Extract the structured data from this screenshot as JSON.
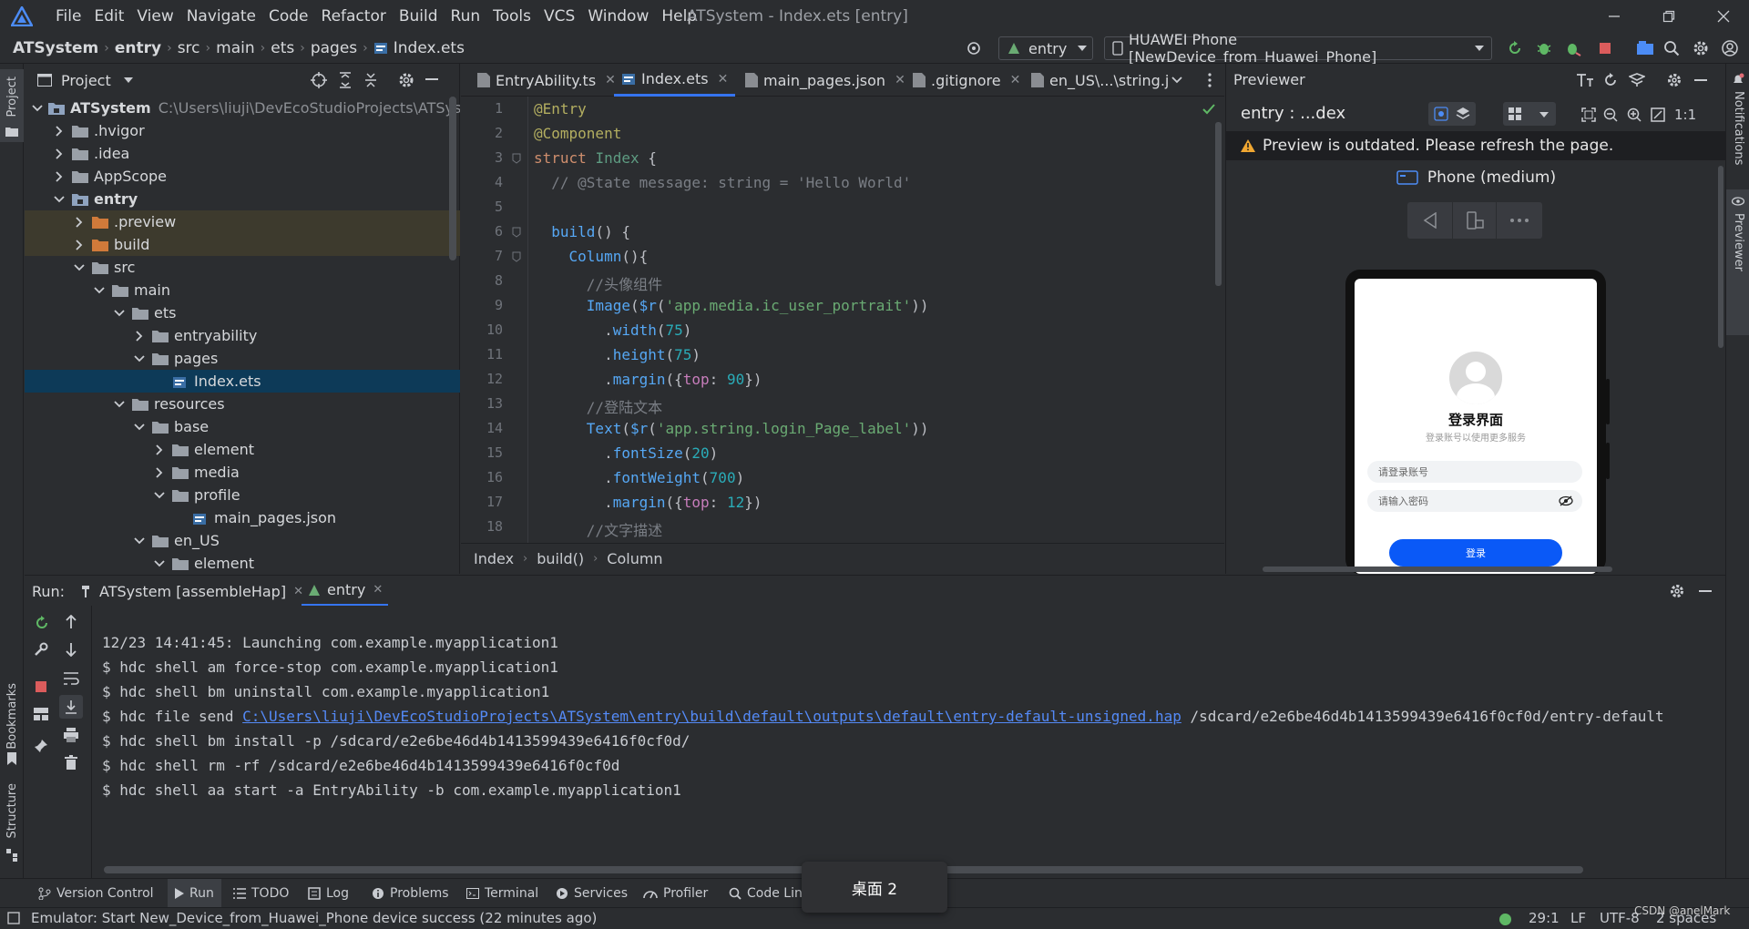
{
  "menubar": {
    "items": [
      "File",
      "Edit",
      "View",
      "Navigate",
      "Code",
      "Refactor",
      "Build",
      "Run",
      "Tools",
      "VCS",
      "Window",
      "Help"
    ],
    "window_title": "ATSystem - Index.ets [entry]"
  },
  "navbar": {
    "crumbs": [
      "ATSystem",
      "entry",
      "src",
      "main",
      "ets",
      "pages",
      "Index.ets"
    ],
    "run_config": "entry",
    "device": "HUAWEI Phone [NewDevice_from_Huawei_Phone]"
  },
  "left_strip": {
    "project": "Project",
    "bookmarks": "Bookmarks",
    "structure": "Structure"
  },
  "right_strip": {
    "notifications": "Notifications",
    "previewer": "Previewer"
  },
  "project": {
    "title": "Project",
    "root_path": "C:\\Users\\liuji\\DevEcoStudioProjects\\ATSystem",
    "tree": [
      {
        "label": "ATSystem",
        "indent": 0,
        "open": true,
        "type": "module"
      },
      {
        "label": ".hvigor",
        "indent": 1,
        "open": false,
        "type": "folder"
      },
      {
        "label": ".idea",
        "indent": 1,
        "open": false,
        "type": "folder"
      },
      {
        "label": "AppScope",
        "indent": 1,
        "open": false,
        "type": "folder"
      },
      {
        "label": "entry",
        "indent": 1,
        "open": true,
        "type": "module"
      },
      {
        "label": ".preview",
        "indent": 2,
        "open": false,
        "type": "excluded"
      },
      {
        "label": "build",
        "indent": 2,
        "open": false,
        "type": "excluded"
      },
      {
        "label": "src",
        "indent": 2,
        "open": true,
        "type": "folder"
      },
      {
        "label": "main",
        "indent": 3,
        "open": true,
        "type": "folder"
      },
      {
        "label": "ets",
        "indent": 4,
        "open": true,
        "type": "folder"
      },
      {
        "label": "entryability",
        "indent": 5,
        "open": false,
        "type": "folder"
      },
      {
        "label": "pages",
        "indent": 5,
        "open": true,
        "type": "folder"
      },
      {
        "label": "Index.ets",
        "indent": 6,
        "open": null,
        "type": "file",
        "selected": true
      },
      {
        "label": "resources",
        "indent": 4,
        "open": true,
        "type": "folder"
      },
      {
        "label": "base",
        "indent": 5,
        "open": true,
        "type": "folder"
      },
      {
        "label": "element",
        "indent": 6,
        "open": false,
        "type": "folder"
      },
      {
        "label": "media",
        "indent": 6,
        "open": false,
        "type": "folder"
      },
      {
        "label": "profile",
        "indent": 6,
        "open": true,
        "type": "folder"
      },
      {
        "label": "main_pages.json",
        "indent": 7,
        "open": null,
        "type": "file"
      },
      {
        "label": "en_US",
        "indent": 5,
        "open": true,
        "type": "folder"
      },
      {
        "label": "element",
        "indent": 6,
        "open": true,
        "type": "folder"
      }
    ]
  },
  "editor": {
    "tabs": [
      "EntryAbility.ts",
      "Index.ets",
      "main_pages.json",
      ".gitignore",
      "en_US\\...\\string.j"
    ],
    "active_tab": "Index.ets",
    "line_numbers": [
      "1",
      "2",
      "3",
      "4",
      "5",
      "6",
      "7",
      "8",
      "9",
      "10",
      "11",
      "12",
      "13",
      "14",
      "15",
      "16",
      "17",
      "18"
    ],
    "breadcrumbs": [
      "Index",
      "build()",
      "Column"
    ]
  },
  "previewer": {
    "title": "Previewer",
    "page": "entry : ...dex",
    "warning": "Preview is outdated. Please refresh the page.",
    "device_label": "Phone (medium)",
    "phone": {
      "heading": "登录界面",
      "subtitle": "登录账号以使用更多服务",
      "account_placeholder": "请登录账号",
      "password_placeholder": "请输入密码",
      "login_button": "登录"
    }
  },
  "run": {
    "label": "Run:",
    "tabs": [
      "ATSystem [assembleHap]",
      "entry"
    ],
    "console": [
      "12/23 14:41:45: Launching com.example.myapplication1",
      "$ hdc shell am force-stop com.example.myapplication1",
      "$ hdc shell bm uninstall com.example.myapplication1",
      "$ hdc shell bm install -p /sdcard/e2e6be46d4b1413599439e6416f0cf0d/",
      "$ hdc shell rm -rf /sdcard/e2e6be46d4b1413599439e6416f0cf0d",
      "$ hdc shell aa start -a EntryAbility -b com.example.myapplication1"
    ],
    "file_send_prefix": "$ hdc file send ",
    "file_send_link": "C:\\Users\\liuji\\DevEcoStudioProjects\\ATSystem\\entry\\build\\default\\outputs\\default\\entry-default-unsigned.hap",
    "file_send_suffix": " /sdcard/e2e6be46d4b1413599439e6416f0cf0d/entry-default"
  },
  "toolwindows": [
    "Version Control",
    "Run",
    "TODO",
    "Log",
    "Problems",
    "Terminal",
    "Services",
    "Profiler",
    "Code Lint"
  ],
  "desktop_popup": "桌面 2",
  "status": {
    "message": "Emulator: Start New_Device_from_Huawei_Phone device success (22 minutes ago)",
    "position": "29:1",
    "line_sep": "LF",
    "encoding": "UTF-8",
    "indent": "2 spaces",
    "watermark": "CSDN @anelMark"
  },
  "colors": {
    "accent": "#3574f0",
    "selection": "#0d3a58",
    "bg": "#2b2d30",
    "link": "#548af7"
  }
}
